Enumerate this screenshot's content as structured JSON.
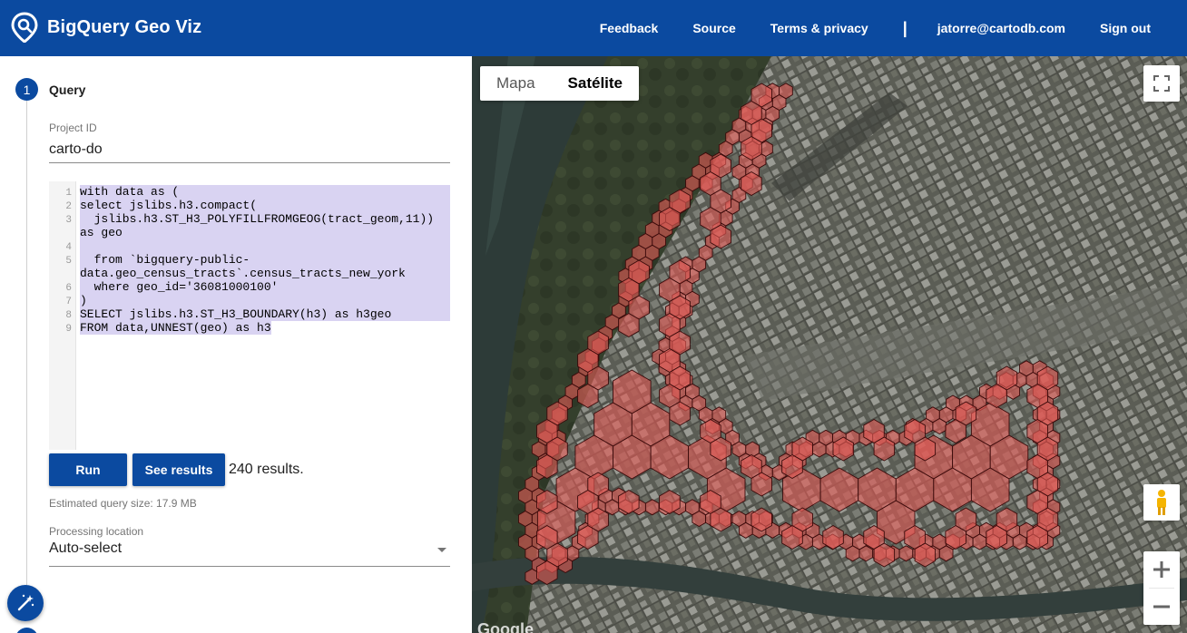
{
  "header": {
    "title": "BigQuery Geo Viz",
    "nav": [
      "Feedback",
      "Source",
      "Terms & privacy"
    ],
    "separator": "|",
    "user_email": "jatorre@cartodb.com",
    "sign_out": "Sign out"
  },
  "query": {
    "step_number": "1",
    "step_title": "Query",
    "project_label": "Project ID",
    "project_value": "carto-do",
    "sql_lines": [
      {
        "n": "1",
        "text": "with data as ("
      },
      {
        "n": "2",
        "text": "select jslibs.h3.compact("
      },
      {
        "n": "3",
        "text": "  jslibs.h3.ST_H3_POLYFILLFROMGEOG(tract_geom,11))",
        "cont": "as geo"
      },
      {
        "n": "4",
        "text": ""
      },
      {
        "n": "5",
        "text": "  from `bigquery-public-",
        "cont": "data.geo_census_tracts`.census_tracts_new_york"
      },
      {
        "n": "6",
        "text": "  where geo_id='36081000100'"
      },
      {
        "n": "7",
        "text": ")"
      },
      {
        "n": "8",
        "text": "SELECT jslibs.h3.ST_H3_BOUNDARY(h3) as h3geo"
      },
      {
        "n": "9",
        "text": "FROM data,UNNEST(geo) as h3"
      }
    ],
    "run_label": "Run",
    "see_results_label": "See results",
    "results_text": "240 results.",
    "estimated_size": "Estimated query size: 17.9 MB",
    "location_label": "Processing location",
    "location_value": "Auto-select"
  },
  "map": {
    "type_options": [
      "Mapa",
      "Satélite"
    ],
    "selected_type": "Satélite",
    "attribution": "Google",
    "hex_fill": "#e05a55",
    "hex_stroke": "#3a0a0a"
  },
  "colors": {
    "brand": "#0b4aa0",
    "highlight": "#d9d3f2"
  }
}
